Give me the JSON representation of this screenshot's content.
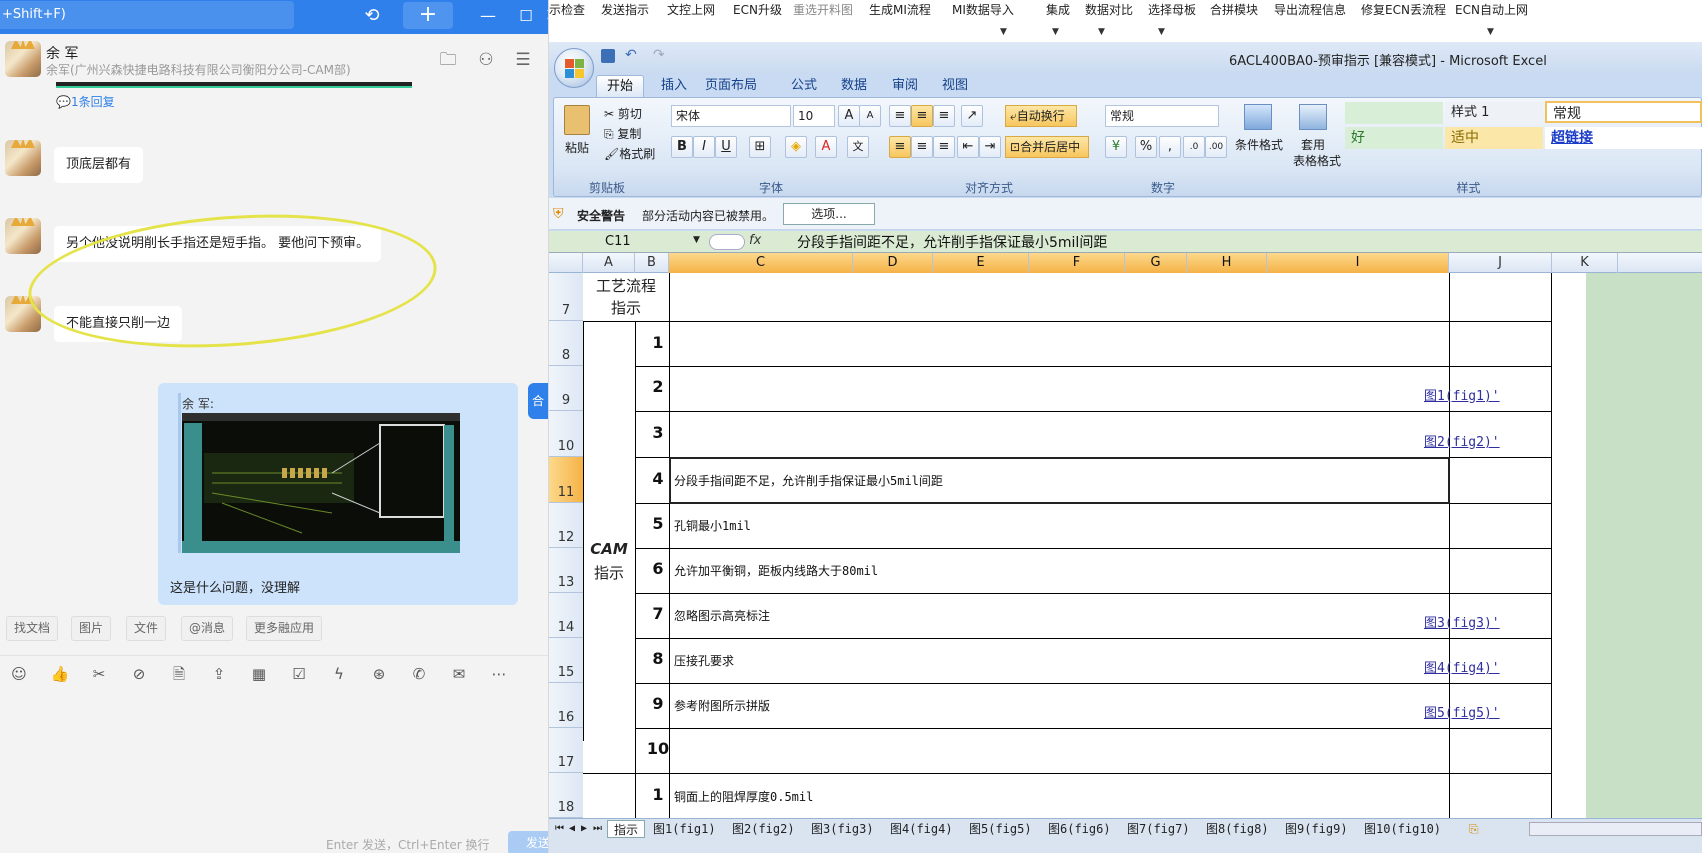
{
  "chat": {
    "search_text": "+Shift+F)",
    "contact_name": "余 军",
    "contact_org": "余军(广州兴森快捷电路科技有限公司衡阳分公司-CAM部)",
    "reply_count": "1条回复",
    "messages": [
      "顶底层都有",
      "另个他没说明削长手指还是短手指。 要他问下预审。",
      "不能直接只削一边"
    ],
    "my_quote_name": "余 军:",
    "my_text": "这是什么问题，没理解",
    "side_tag": "合并",
    "chips": [
      "找文档",
      "图片",
      "文件",
      "@消息",
      "更多融应用"
    ],
    "input_hint": "Enter 发送，Ctrl+Enter 换行",
    "send_label": "发送"
  },
  "plugin_menu": [
    "示检查",
    "发送指示",
    "文控上网",
    "ECN升级",
    "重选开料图",
    "生成MI流程",
    "MI数据导入",
    "集成",
    "数据对比",
    "选择母板",
    "合拼模块",
    "导出流程信息",
    "修复ECN丢流程",
    "ECN自动上网"
  ],
  "excel": {
    "window_title": "6ACL400BA0-预审指示 [兼容模式] - Microsoft Excel",
    "tabs": [
      "开始",
      "插入",
      "页面布局",
      "公式",
      "数据",
      "审阅",
      "视图"
    ],
    "ribbon": {
      "paste": "粘贴",
      "cut": "剪切",
      "copy": "复制",
      "format_painter": "格式刷",
      "clipboard_group": "剪贴板",
      "font_name": "宋体",
      "font_size": "10",
      "font_group": "字体",
      "wrap_text": "自动换行",
      "merge_center": "合并后居中",
      "align_group": "对齐方式",
      "number_format": "常规",
      "number_group": "数字",
      "cond_format": "条件格式",
      "table_format_1": "套用",
      "table_format_2": "表格格式",
      "styles_group": "样式",
      "style_1": "样式 1",
      "style_normal": "常规",
      "style_good": "好",
      "style_neutral": "适中",
      "style_hyperlink": "超链接"
    },
    "security_label": "安全警告",
    "security_msg": "部分活动内容已被禁用。",
    "options_button": "选项...",
    "name_box": "C11",
    "formula": "分段手指间距不足，允许削手指保证最小5mil间距",
    "columns": [
      "A",
      "B",
      "C",
      "D",
      "E",
      "F",
      "G",
      "H",
      "I",
      "J",
      "K"
    ],
    "rows": [
      "7",
      "8",
      "9",
      "10",
      "11",
      "12",
      "13",
      "14",
      "15",
      "16",
      "17",
      "18"
    ],
    "a7_line1": "工艺流程",
    "a7_line2": "指示",
    "cam_line1": "CAM",
    "cam_line2": "指示",
    "items": [
      {
        "n": "1",
        "text": "",
        "link": ""
      },
      {
        "n": "2",
        "text": "",
        "link": "图1(fig1)'"
      },
      {
        "n": "3",
        "text": "",
        "link": "图2(fig2)'"
      },
      {
        "n": "4",
        "text": "分段手指间距不足，允许削手指保证最小5mil间距",
        "link": ""
      },
      {
        "n": "5",
        "text": "孔铜最小1mil",
        "link": ""
      },
      {
        "n": "6",
        "text": "允许加平衡铜，距板内线路大于80mil",
        "link": ""
      },
      {
        "n": "7",
        "text": "忽略图示高亮标注",
        "link": "图3(fig3)'"
      },
      {
        "n": "8",
        "text": "压接孔要求",
        "link": "图4(fig4)'"
      },
      {
        "n": "9",
        "text": "参考附图所示拼版",
        "link": "图5(fig5)'"
      },
      {
        "n": "10",
        "text": "",
        "link": ""
      }
    ],
    "row18": {
      "n": "1",
      "text": "铜面上的阻焊厚度0.5mil"
    },
    "sheet_tabs": [
      "指示",
      "图1(fig1)",
      "图2(fig2)",
      "图3(fig3)",
      "图4(fig4)",
      "图5(fig5)",
      "图6(fig6)",
      "图7(fig7)",
      "图8(fig8)",
      "图9(fig9)",
      "图10(fig10)"
    ]
  }
}
